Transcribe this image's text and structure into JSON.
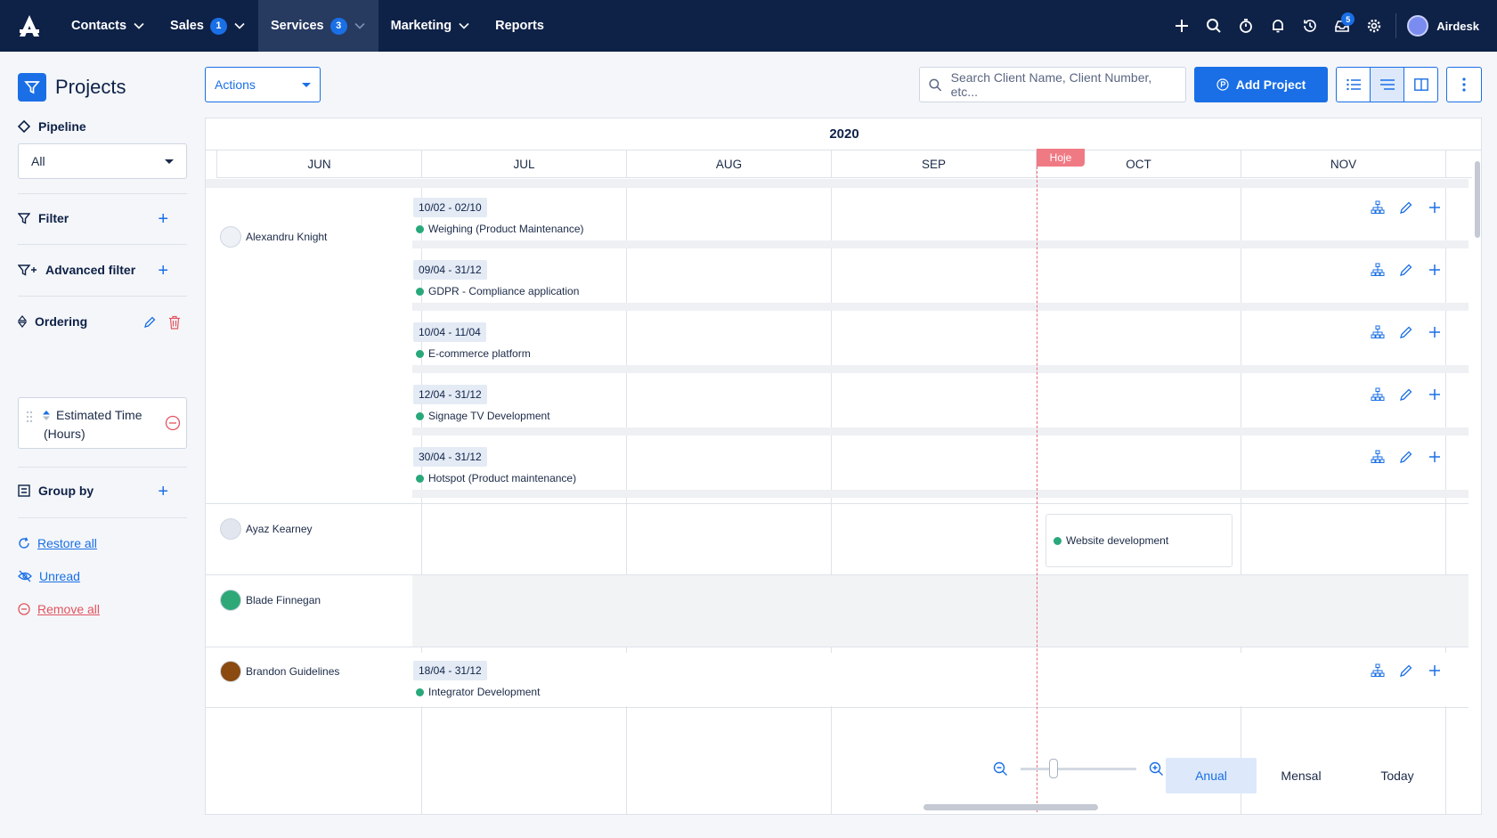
{
  "nav": {
    "items": [
      {
        "label": "Contacts",
        "badge": "",
        "has_menu": true
      },
      {
        "label": "Sales",
        "badge": "1",
        "has_menu": true
      },
      {
        "label": "Services",
        "badge": "3",
        "has_menu": true,
        "active": true
      },
      {
        "label": "Marketing",
        "badge": "",
        "has_menu": true
      },
      {
        "label": "Reports",
        "badge": "",
        "has_menu": false
      }
    ],
    "icons": [
      "plus-icon",
      "search-icon",
      "timer-icon",
      "bell-icon",
      "history-icon",
      "inbox-icon",
      "gear-icon"
    ],
    "inbox_badge": "5",
    "user_name": "Airdesk"
  },
  "sidebar": {
    "title": "Projects",
    "pipeline_label": "Pipeline",
    "pipeline_value": "All",
    "filter_label": "Filter",
    "advanced_filter_label": "Advanced filter",
    "ordering_label": "Ordering",
    "ordering_item_line1": "Estimated Time",
    "ordering_item_line2": "(Hours)",
    "group_by_label": "Group by",
    "restore_all": "Restore all",
    "unread": "Unread",
    "remove_all": "Remove all"
  },
  "toolbar": {
    "actions_label": "Actions",
    "search_placeholder": "Search Client Name, Client Number, etc...",
    "add_project_label": "Add Project"
  },
  "gantt": {
    "year": "2020",
    "months": [
      "JUN",
      "JUL",
      "AUG",
      "SEP",
      "OCT",
      "NOV"
    ],
    "today_label": "Hoje",
    "people": [
      "Alexandru Knight",
      "Ayaz Kearney",
      "Blade Finnegan",
      "Brandon Guidelines"
    ],
    "projects": [
      {
        "date": "10/02 - 02/10",
        "name": "Weighing (Product Maintenance)"
      },
      {
        "date": "09/04 - 31/12",
        "name": "GDPR - Compliance application"
      },
      {
        "date": "10/04 - 11/04",
        "name": "E-commerce platform"
      },
      {
        "date": "12/04 - 31/12",
        "name": "Signage TV Development"
      },
      {
        "date": "30/04 - 31/12",
        "name": "Hotspot (Product maintenance)"
      },
      {
        "date": "18/04 - 31/12",
        "name": "Integrator Development"
      }
    ],
    "card_project": "Website development",
    "status_color": "#28a87b",
    "today_color": "#f07a84"
  },
  "footer": {
    "modes": [
      "Anual",
      "Mensal",
      "Today"
    ],
    "active_mode": "Anual"
  },
  "colors": {
    "accent": "#1a6fe6",
    "nav_bg": "#0e2147",
    "danger": "#e2545f"
  }
}
